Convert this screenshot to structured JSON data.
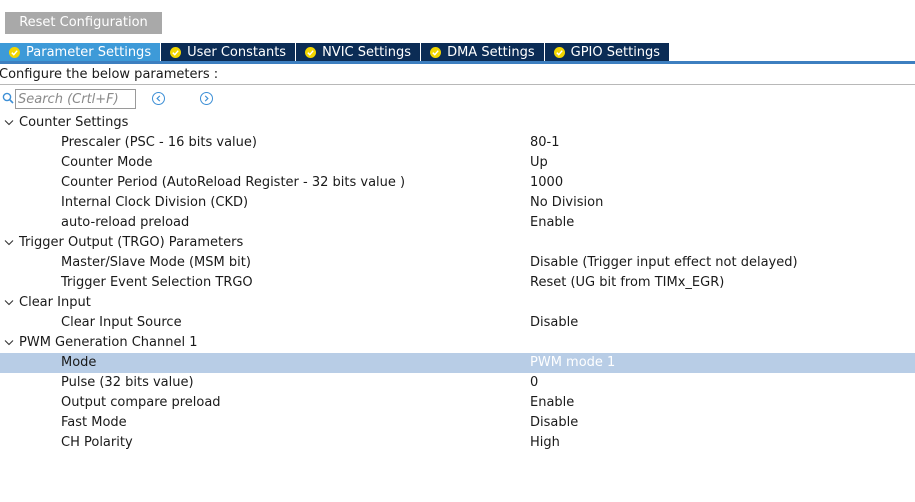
{
  "toolbar": {
    "reset_label": "Reset Configuration"
  },
  "tabs": [
    {
      "label": "Parameter Settings",
      "active": true
    },
    {
      "label": "User Constants",
      "active": false
    },
    {
      "label": "NVIC Settings",
      "active": false
    },
    {
      "label": "DMA Settings",
      "active": false
    },
    {
      "label": "GPIO Settings",
      "active": false
    }
  ],
  "configure_label": "Configure the below parameters :",
  "search": {
    "placeholder": "Search (Crtl+F)",
    "value": ""
  },
  "groups": [
    {
      "label": "Counter Settings",
      "params": [
        {
          "name": "Prescaler (PSC - 16 bits value)",
          "value": "80-1"
        },
        {
          "name": "Counter Mode",
          "value": "Up"
        },
        {
          "name": "Counter Period (AutoReload Register - 32 bits value )",
          "value": "1000"
        },
        {
          "name": "Internal Clock Division (CKD)",
          "value": "No Division"
        },
        {
          "name": "auto-reload preload",
          "value": "Enable"
        }
      ]
    },
    {
      "label": "Trigger Output (TRGO) Parameters",
      "params": [
        {
          "name": "Master/Slave Mode (MSM bit)",
          "value": "Disable (Trigger input effect not delayed)"
        },
        {
          "name": "Trigger Event Selection TRGO",
          "value": "Reset (UG bit from TIMx_EGR)"
        }
      ]
    },
    {
      "label": "Clear Input",
      "params": [
        {
          "name": "Clear Input Source",
          "value": "Disable"
        }
      ]
    },
    {
      "label": "PWM Generation Channel 1",
      "params": [
        {
          "name": "Mode",
          "value": "PWM mode 1",
          "selected": true
        },
        {
          "name": "Pulse (32 bits value)",
          "value": "0"
        },
        {
          "name": "Output compare preload",
          "value": "Enable"
        },
        {
          "name": "Fast Mode",
          "value": "Disable"
        },
        {
          "name": "CH Polarity",
          "value": "High"
        }
      ]
    }
  ],
  "colors": {
    "tab_bg": "#0b2c55",
    "tab_active_bg": "#3d9ad8",
    "check_yellow": "#f2d600",
    "selected_row": "#b8cde6",
    "reset_btn": "#a9a9a9"
  }
}
